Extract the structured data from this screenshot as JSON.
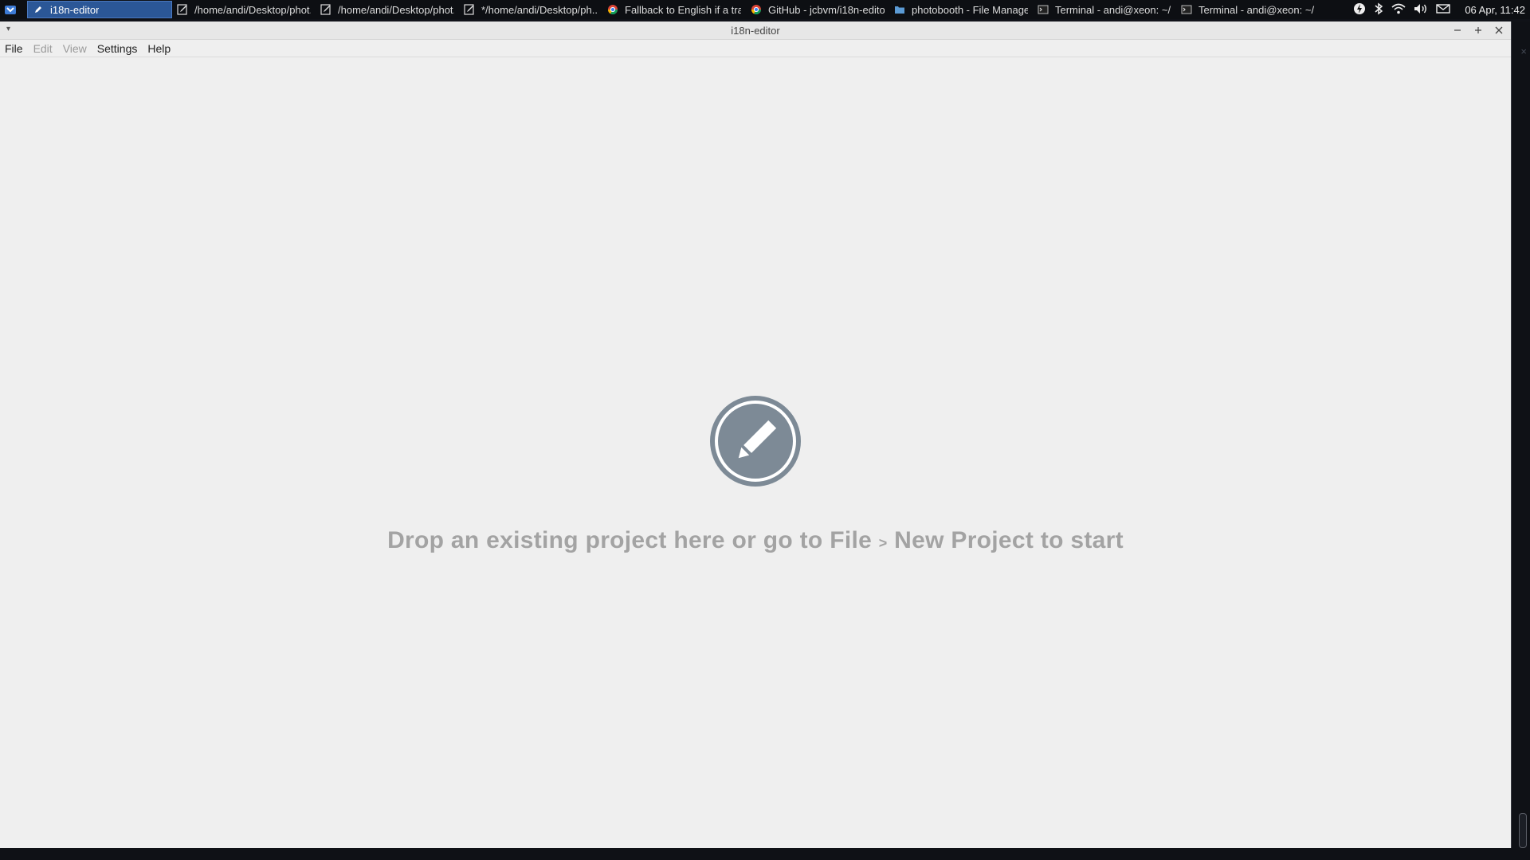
{
  "taskbar": {
    "tasks": [
      {
        "label": "i18n-editor",
        "icon": "pencil-icon",
        "active": true
      },
      {
        "label": "/home/andi/Desktop/phot...",
        "icon": "text-editor-icon",
        "active": false
      },
      {
        "label": "/home/andi/Desktop/phot...",
        "icon": "text-editor-icon",
        "active": false
      },
      {
        "label": "*/home/andi/Desktop/ph...",
        "icon": "text-editor-icon",
        "active": false
      },
      {
        "label": "Fallback to English if a tra...",
        "icon": "chrome-icon",
        "active": false
      },
      {
        "label": "GitHub - jcbvm/i18n-edito...",
        "icon": "chrome-icon",
        "active": false
      },
      {
        "label": "photobooth - File Manager",
        "icon": "folder-icon",
        "active": false
      },
      {
        "label": "Terminal - andi@xeon: ~/...",
        "icon": "terminal-icon",
        "active": false
      },
      {
        "label": "Terminal - andi@xeon: ~/...",
        "icon": "terminal-icon",
        "active": false
      }
    ],
    "clock": "06 Apr, 11:42"
  },
  "window": {
    "title": "i18n-editor"
  },
  "menubar": {
    "items": [
      {
        "label": "File",
        "enabled": true
      },
      {
        "label": "Edit",
        "enabled": false
      },
      {
        "label": "View",
        "enabled": false
      },
      {
        "label": "Settings",
        "enabled": true
      },
      {
        "label": "Help",
        "enabled": true
      }
    ]
  },
  "main": {
    "empty_message_part1": "Drop an existing project here or go to File",
    "empty_message_sep": ">",
    "empty_message_part2": "New Project to start"
  },
  "colors": {
    "accent": "#2b5797",
    "icon_fill": "#7d8a96",
    "empty_text": "#a3a3a3",
    "window_bg": "#efefef"
  }
}
